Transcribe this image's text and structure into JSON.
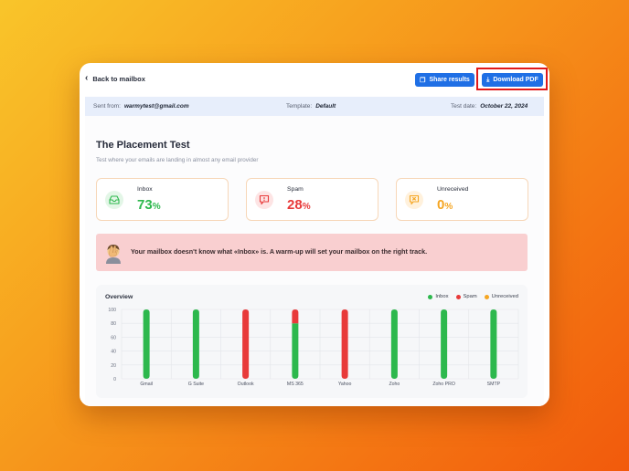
{
  "header": {
    "back_label": "Back to mailbox",
    "share_label": "Share results",
    "download_label": "Download PDF"
  },
  "info": {
    "sent_from_label": "Sent from:",
    "sent_from_value": "warmytest@gmail.com",
    "template_label": "Template:",
    "template_value": "Default",
    "test_date_label": "Test date:",
    "test_date_value": "October 22, 2024"
  },
  "main": {
    "title": "The Placement Test",
    "subtitle": "Test where your emails are landing in almost any email provider"
  },
  "cards": [
    {
      "label": "Inbox",
      "value": "73",
      "unit": "%",
      "color": "#2db84d",
      "icon": "inbox-tray-icon"
    },
    {
      "label": "Spam",
      "value": "28",
      "unit": "%",
      "color": "#e83a3a",
      "icon": "spam-alert-icon"
    },
    {
      "label": "Unreceived",
      "value": "0",
      "unit": "%",
      "color": "#f5a623",
      "icon": "unreceived-x-icon"
    }
  ],
  "alert": {
    "message": "Your mailbox doesn't know what «Inbox» is. A warm-up will set your mailbox on the right track."
  },
  "colors": {
    "inbox": "#2db84d",
    "spam": "#e83a3a",
    "unreceived": "#f5a623",
    "accent": "#1f6fe5"
  },
  "chart_data": {
    "type": "bar",
    "title": "Overview",
    "categories": [
      "Gmail",
      "G Suite",
      "Outlook",
      "MS 365",
      "Yahoo",
      "Zoho",
      "Zoho PRO",
      "SMTP"
    ],
    "series": [
      {
        "name": "Inbox",
        "values": [
          100,
          100,
          0,
          80,
          0,
          100,
          100,
          100
        ]
      },
      {
        "name": "Spam",
        "values": [
          0,
          0,
          100,
          20,
          100,
          0,
          0,
          0
        ]
      },
      {
        "name": "Unreceived",
        "values": [
          0,
          0,
          0,
          0,
          0,
          0,
          0,
          0
        ]
      }
    ],
    "yticks": [
      0,
      20,
      40,
      60,
      80,
      100
    ],
    "ylim": [
      0,
      100
    ],
    "stacked": true,
    "grid": true,
    "legend_position": "top-right"
  }
}
